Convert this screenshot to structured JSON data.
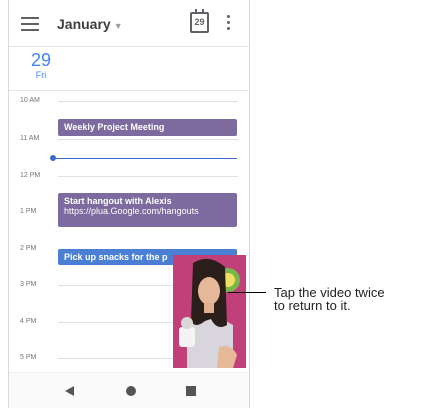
{
  "header": {
    "month": "January",
    "calendar_day": "29"
  },
  "day": {
    "number": "29",
    "name": "Fri"
  },
  "hours": [
    "10 AM",
    "11 AM",
    "12 PM",
    "1 PM",
    "2 PM",
    "3 PM",
    "4 PM",
    "5 PM"
  ],
  "events": [
    {
      "title": "Weekly Project Meeting"
    },
    {
      "title": "Start hangout with Alexis",
      "link": "https://plua.Google.com/hangouts"
    },
    {
      "title": "Pick up snacks for the p"
    }
  ],
  "callout": {
    "line1": "Tap the video twice",
    "line2": "to return to it."
  },
  "colors": {
    "accent": "#4285f4",
    "event_purple": "#7d6a9e",
    "event_blue": "#4a7fd4"
  }
}
